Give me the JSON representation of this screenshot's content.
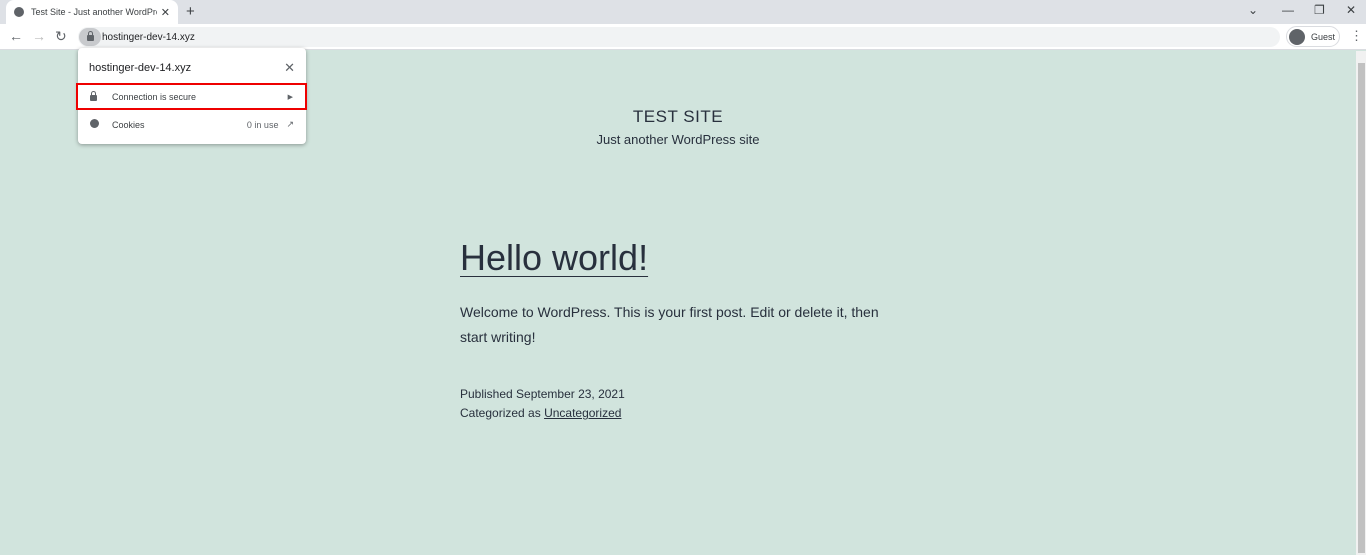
{
  "browser": {
    "tab_title": "Test Site - Just another WordPress site",
    "url": "hostinger-dev-14.xyz",
    "profile": "Guest"
  },
  "popup": {
    "title": "hostinger-dev-14.xyz",
    "connection": "Connection is secure",
    "cookies": "Cookies",
    "cookies_count": "0 in use",
    "highlight_color": "#e00000"
  },
  "site": {
    "title": "TEST SITE",
    "description": "Just another WordPress site"
  },
  "post": {
    "title": "Hello world!",
    "body": "Welcome to WordPress. This is your first post. Edit or delete it, then start writing!",
    "published": "Published September 23, 2021",
    "category_prefix": "Categorized as",
    "category": "Uncategorized"
  },
  "colors": {
    "background": "#d1e4dd",
    "text": "#28303d"
  }
}
